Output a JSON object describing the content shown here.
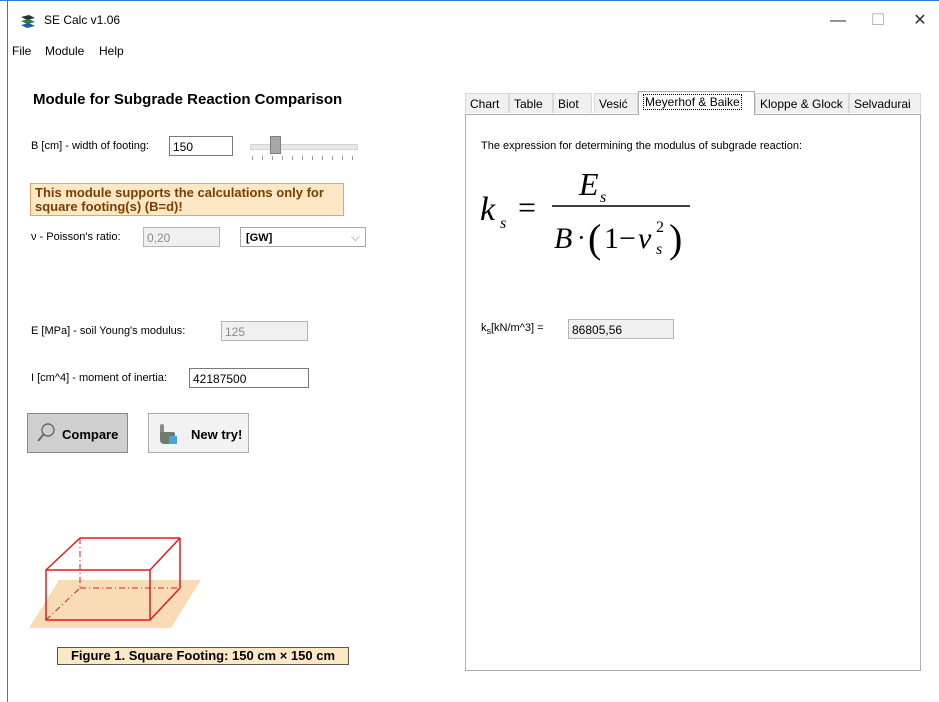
{
  "window": {
    "title": "SE Calc v1.06",
    "minimize": "—",
    "maximize": "☐",
    "close": "✕"
  },
  "menu": [
    "File",
    "Module",
    "Help"
  ],
  "module": {
    "title": "Module for Subgrade Reaction Comparison",
    "width_label": "B [cm] - width of footing:",
    "width_value": "150",
    "warning_line1": "This module  supports the calculations only for",
    "warning_line2": "square footing(s) (B=d)!",
    "poisson_label": "ν - Poisson's ratio:",
    "poisson_value": "0,20",
    "soil_type": "[GW]",
    "young_label": "E [MPa] - soil Young's modulus:",
    "young_value": "125",
    "inertia_label": "I [cm^4] - moment of inertia:",
    "inertia_value": "42187500",
    "compare_label": "Compare",
    "newtry_label": "New try!",
    "figure_caption": "Figure 1. Square Footing: 150 cm × 150 cm"
  },
  "tabs": [
    {
      "label": "Chart"
    },
    {
      "label": "Table"
    },
    {
      "label": "Biot"
    },
    {
      "label": "Vesić"
    },
    {
      "label": "Meyerhof & Baike"
    },
    {
      "label": "Kloppe & Glock"
    },
    {
      "label": "Selvadurai"
    }
  ],
  "panel": {
    "description": "The expression for determining the modulus of subgrade reaction:",
    "ks_label_prefix": "k",
    "ks_label_sub": "s",
    "ks_label_suffix": "[kN/m^3] =",
    "ks_value": "86805,56"
  },
  "colors": {
    "accent_border": "#2b79d8",
    "warning_bg": "#fde7c4",
    "footing_red": "#e31b1b",
    "footing_base": "#f9dcb6"
  }
}
